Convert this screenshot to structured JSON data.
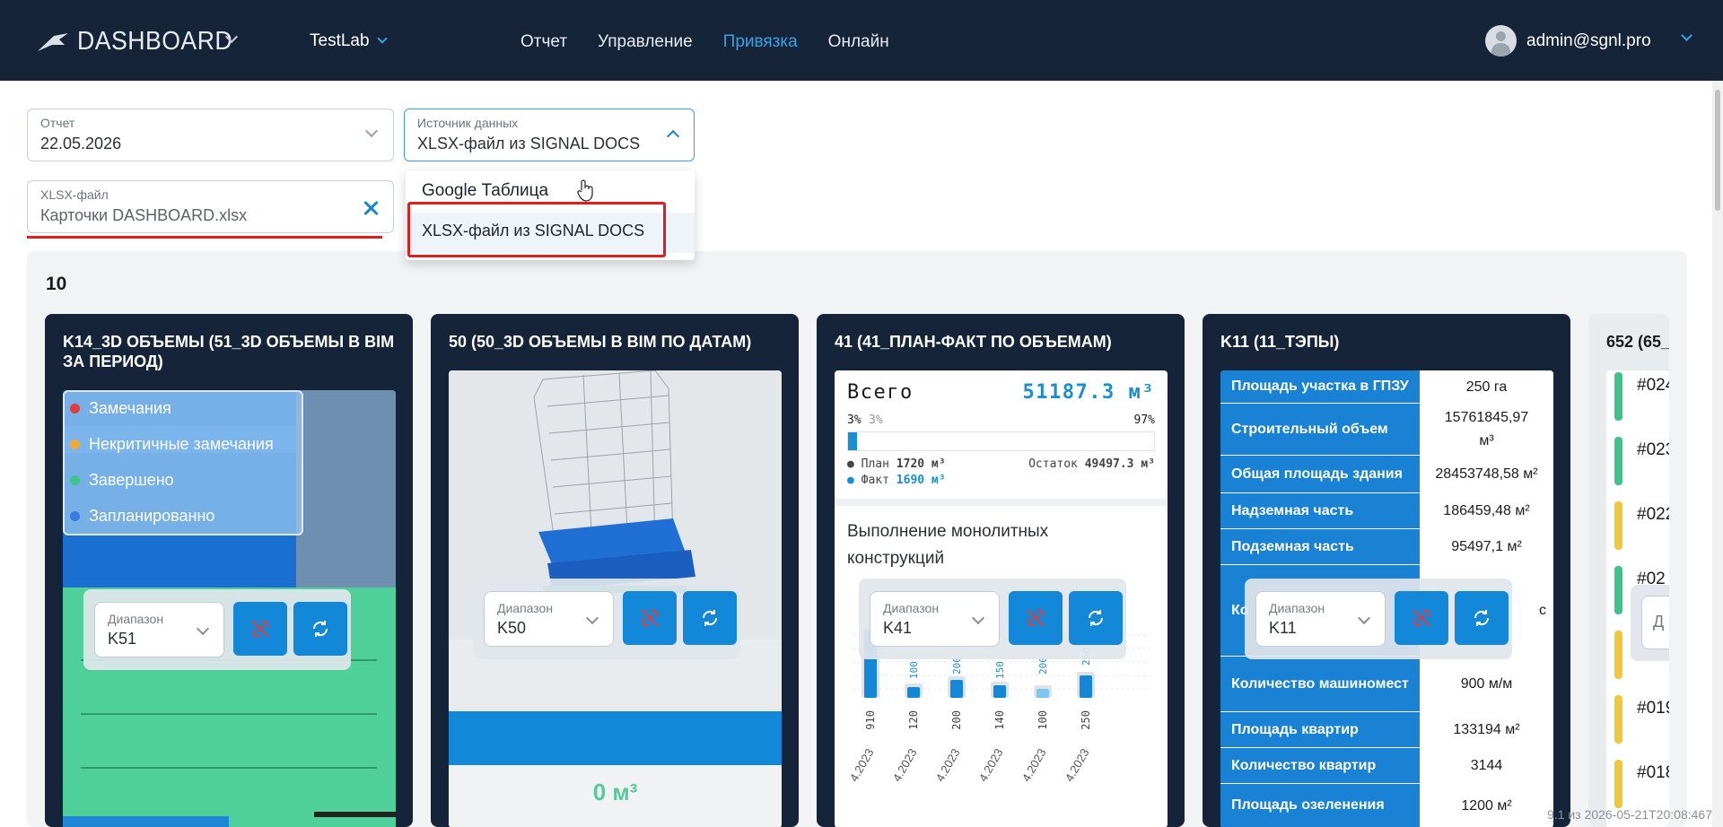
{
  "header": {
    "logo_text": "DASHBOARD",
    "project": "TestLab",
    "nav": [
      "Отчет",
      "Управление",
      "Привязка",
      "Онлайн"
    ],
    "active_nav": "Привязка",
    "user": "admin@sgnl.pro"
  },
  "filters": {
    "report": {
      "label": "Отчет",
      "value": "22.05.2026"
    },
    "source": {
      "label": "Источник данных",
      "value": "XLSX-файл из SIGNAL DOCS"
    },
    "file": {
      "label": "XLSX-файл",
      "value": "Карточки DASHBOARD.xlsx"
    },
    "source_options": [
      "Google Таблица",
      "XLSX-файл из SIGNAL DOCS"
    ]
  },
  "panel": {
    "count": "10"
  },
  "cards": {
    "c1": {
      "title": "K14_3D ОБЪЕМЫ (51_3D ОБЪЕМЫ В BIM ЗА ПЕРИОД)",
      "legend": [
        {
          "label": "Замечания",
          "color": "#e23b3b"
        },
        {
          "label": "Некритичные замечания",
          "color": "#f0a93a"
        },
        {
          "label": "Завершено",
          "color": "#3cc48a"
        },
        {
          "label": "Запланированно",
          "color": "#3a7be0"
        }
      ],
      "range_label": "Диапазон",
      "range_value": "K51"
    },
    "c2": {
      "title": "50 (50_3D ОБЪЕМЫ В BIM ПО ДАТАМ)",
      "range_label": "Диапазон",
      "range_value": "K50",
      "volume": "0 м³"
    },
    "c3": {
      "title": "41 (41_ПЛАН-ФАКТ ПО ОБЪЕМАМ)",
      "total_label": "Всего",
      "total_value": "51187.3 м³",
      "pct_left": "3%",
      "pct_left2": "3%",
      "pct_right": "97%",
      "plan_label": "План",
      "plan_value": "1720 м³",
      "fact_label": "Факт",
      "fact_value": "1690 м³",
      "rest_label": "Остаток",
      "rest_value": "49497.3 м³",
      "subtitle": "Выполнение монолитных конструкций",
      "range_label": "Диапазон",
      "range_value": "K41",
      "bars_plan": [
        "100",
        "200",
        "150",
        "200",
        "250"
      ],
      "bars_fact": [
        "910",
        "120",
        "200",
        "140",
        "100",
        "250"
      ],
      "dates": [
        "4.2023",
        "4.2023",
        "4.2023",
        "4.2023",
        "4.2023",
        "4.2023"
      ]
    },
    "c4": {
      "title": "K11 (11_ТЭПЫ)",
      "rows": [
        {
          "k": "Площадь участка в ГПЗУ",
          "v": "250 га"
        },
        {
          "k": "Строительный объем",
          "v": "15761845,97 м³"
        },
        {
          "k": "Общая площадь здания",
          "v": "28453748,58 м²"
        },
        {
          "k": "Надземная часть",
          "v": "186459,48 м²"
        },
        {
          "k": "Подземная часть",
          "v": "95497,1 м²"
        },
        {
          "k": "Ко",
          "v": "с"
        },
        {
          "k": "Количество машиномест",
          "v": "900 м/м"
        },
        {
          "k": "Площадь квартир",
          "v": "133194 м²"
        },
        {
          "k": "Количество квартир",
          "v": "3144"
        },
        {
          "k": "Площадь озеленения",
          "v": "1200 м²"
        }
      ],
      "range_label": "Диапазон",
      "range_value": "K11"
    },
    "c5": {
      "title": "652 (65_",
      "items": [
        {
          "text": "#024",
          "color": "#3cc48a"
        },
        {
          "text": "#023",
          "color": "#3cc48a"
        },
        {
          "text": "#022",
          "color": "#f0c93a"
        },
        {
          "text": "#02",
          "color": "#3cc48a"
        },
        {
          "text": "",
          "color": "#f0c93a"
        },
        {
          "text": "#019",
          "color": "#f0c93a"
        },
        {
          "text": "#018",
          "color": "#f0c93a"
        }
      ],
      "range_partial": "Д"
    }
  },
  "footer": {
    "version": "9.1 из 2026-05-21T20:08:467"
  }
}
